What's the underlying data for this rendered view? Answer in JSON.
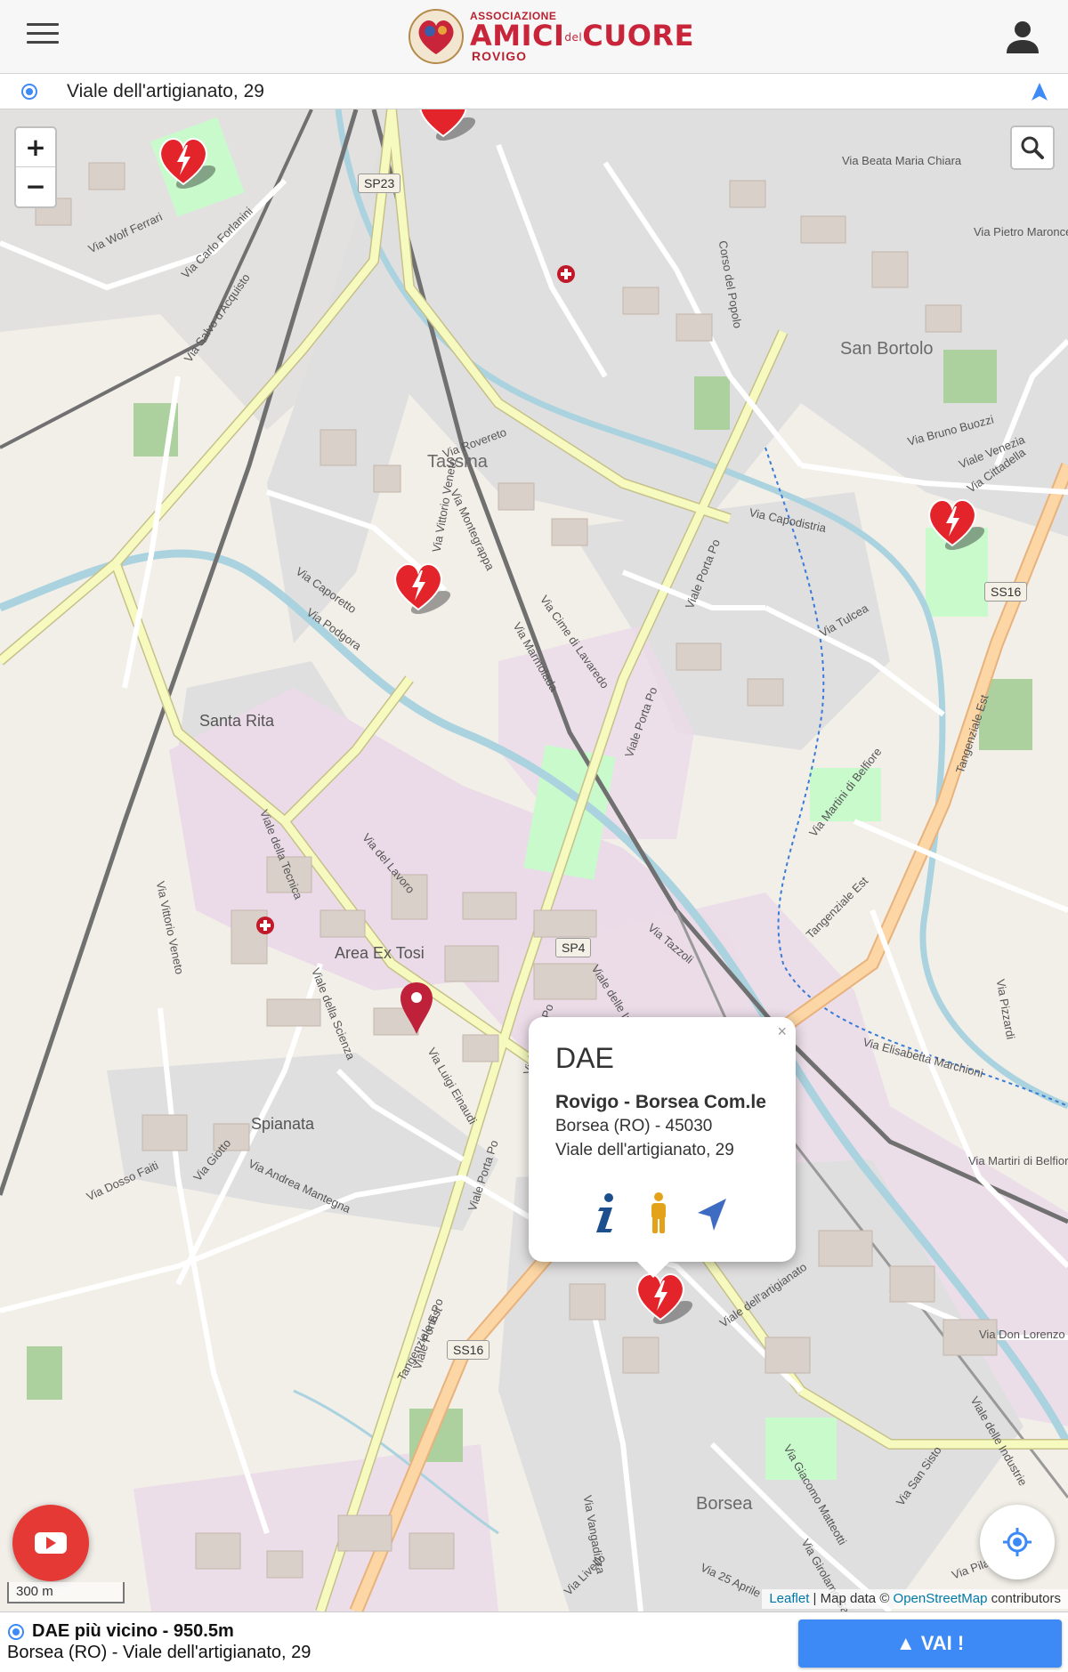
{
  "header": {
    "logo_assoc": "ASSOCIAZIONE",
    "logo_main_a": "AMICI",
    "logo_main_del": "del",
    "logo_main_b": "CUORE",
    "logo_city": "ROVIGO",
    "menu_icon": "hamburger-icon",
    "user_icon": "account-icon"
  },
  "address_bar": {
    "text": "Viale dell'artigianato, 29",
    "left_icon": "location-pin-icon",
    "right_icon": "navigation-arrow-icon"
  },
  "map": {
    "zoom_in": "+",
    "zoom_out": "−",
    "place_labels": [
      "San Bortolo",
      "Tassina",
      "Santa Rita",
      "Area Ex Tosi",
      "Spianata",
      "Borsea"
    ],
    "road_shields": [
      "SP23",
      "SS16",
      "SP4",
      "SS16"
    ],
    "streets": [
      "Via Salvo d'Acquisto",
      "Via del Lavoro",
      "Viale Porta Po",
      "Viale Porta Po",
      "Viale Porta Po",
      "Viale Porta Po",
      "Viale Porta Po",
      "Tangenziale Est",
      "Tangenziale Est",
      "Tangenziale Est",
      "Via Vittorio Veneto",
      "Via Vittorio Veneto",
      "Viale della Tecnica",
      "Viale della Scienza",
      "Via Luigi Einaudi",
      "Viale delle Industrie",
      "Viale delle Industrie",
      "Viale dell'artigianato",
      "Via Don Lorenzo",
      "Via Martiri di Belfiore",
      "Via Martini di Belfiore",
      "Via Elisabetta Marchioni",
      "Via Capodistria",
      "Via Tulcea",
      "Via Dosso Faiti",
      "Via Giotto",
      "Via Andrea Mantegna",
      "Via Tazzoli",
      "Via Marmolada",
      "Via Cime di Lavaredo",
      "Via Caporetto",
      "Via Podgora",
      "Via Rovereto",
      "Via Montegrappa",
      "Via Beata Maria Chiara",
      "Via Pietro Maroncelli",
      "Via Carlo Forlanini",
      "Via Wolf Ferrari",
      "Corso del Popolo",
      "Viale Venezia",
      "Via Cittadella",
      "Via Bruno Buozzi",
      "Via Giacomo Matteotti",
      "Via Girolamo Savonarola",
      "Via 25 Aprile",
      "Via San Sisto",
      "Via Pilastri",
      "Via Vangadizza",
      "Via Livello",
      "Via Pizzardi"
    ],
    "marker_icon": "aed-heart-marker-icon",
    "pin_icon": "current-location-pin-icon",
    "hospital_icon": "hospital-cross-icon",
    "search_icon": "search-icon",
    "youtube_icon": "youtube-icon",
    "locate_icon": "my-location-icon",
    "scale": "300 m",
    "attribution_leaflet": "Leaflet",
    "attribution_sep": " | Map data © ",
    "attribution_osm": "OpenStreetMap",
    "attribution_tail": " contributors"
  },
  "popup": {
    "close": "×",
    "title": "DAE",
    "name": "Rovigo - Borsea Com.le",
    "line1": "Borsea (RO) - 45030",
    "line2": "Viale dell'artigianato, 29",
    "icons": [
      "info-icon",
      "pedestrian-icon",
      "directions-icon"
    ]
  },
  "bottom_bar": {
    "title": "DAE più vicino - 950.5m",
    "subtitle": "Borsea (RO) - Viale dell'artigianato, 29",
    "go_label": "▲ VAI !"
  },
  "colors": {
    "brand_red": "#c8243a",
    "go_button": "#3d8af7",
    "marker_red": "#e3242b",
    "youtube_red": "#e53935",
    "major_road_yellow": "#f7fabf",
    "tangenziale_orange": "#fcd6a4",
    "industrial_pink": "#ebdbe8",
    "water_blue": "#aad3df"
  }
}
